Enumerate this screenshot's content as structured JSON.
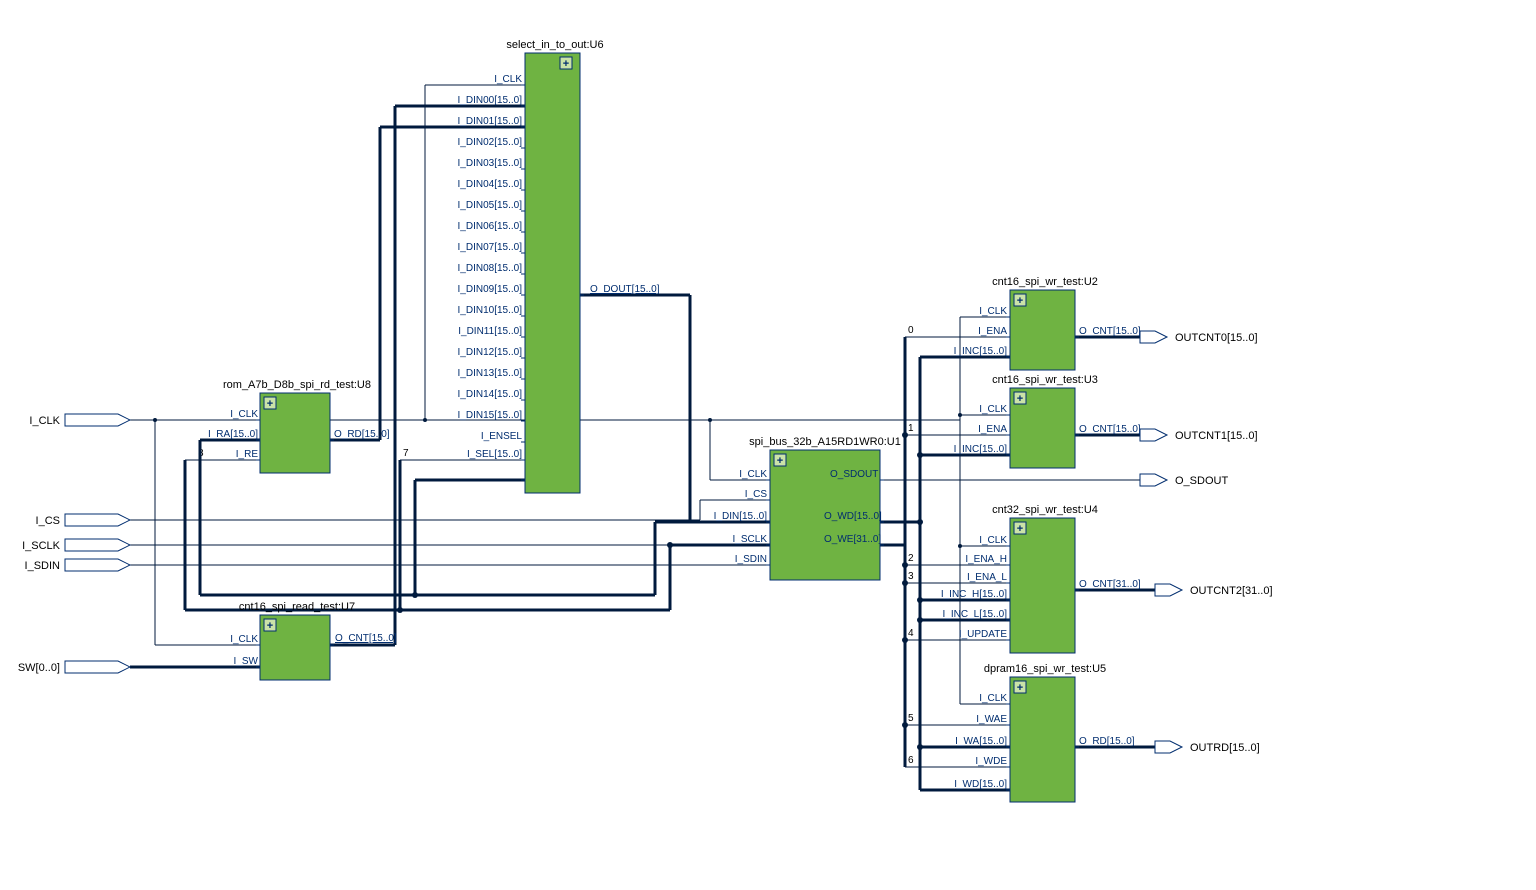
{
  "inputs": {
    "i_clk": "I_CLK",
    "i_cs": "I_CS",
    "i_sclk": "I_SCLK",
    "i_sdin": "I_SDIN",
    "sw": "SW[0..0]"
  },
  "outputs": {
    "outcnt0": "OUTCNT0[15..0]",
    "outcnt1": "OUTCNT1[15..0]",
    "o_sdout": "O_SDOUT",
    "outcnt2": "OUTCNT2[31..0]",
    "outrd": "OUTRD[15..0]"
  },
  "blocks": {
    "u8": {
      "title": "rom_A7b_D8b_spi_rd_test:U8",
      "pins_left": [
        "I_CLK",
        "I_RA[15..0]",
        "I_RE"
      ],
      "pins_right": [
        "O_RD[15..0]"
      ]
    },
    "u7": {
      "title": "cnt16_spi_read_test:U7",
      "pins_left": [
        "I_CLK",
        "I_SW"
      ],
      "pins_right": [
        "O_CNT[15..0]"
      ]
    },
    "u6": {
      "title": "select_in_to_out:U6",
      "pins_left": [
        "I_CLK",
        "I_DIN00[15..0]",
        "I_DIN01[15..0]",
        "I_DIN02[15..0]",
        "I_DIN03[15..0]",
        "I_DIN04[15..0]",
        "I_DIN05[15..0]",
        "I_DIN06[15..0]",
        "I_DIN07[15..0]",
        "I_DIN08[15..0]",
        "I_DIN09[15..0]",
        "I_DIN10[15..0]",
        "I_DIN11[15..0]",
        "I_DIN12[15..0]",
        "I_DIN13[15..0]",
        "I_DIN14[15..0]",
        "I_DIN15[15..0]",
        "I_ENSEL",
        "I_SEL[15..0]"
      ],
      "pins_right": [
        "O_DOUT[15..0]"
      ]
    },
    "u1": {
      "title": "spi_bus_32b_A15RD1WR0:U1",
      "pins_left": [
        "I_CLK",
        "I_CS",
        "I_DIN[15..0]",
        "I_SCLK",
        "I_SDIN"
      ],
      "pins_right": [
        "O_SDOUT",
        "O_WD[15..0]",
        "O_WE[31..0]"
      ]
    },
    "u2": {
      "title": "cnt16_spi_wr_test:U2",
      "pins_left": [
        "I_CLK",
        "I_ENA",
        "I_INC[15..0]"
      ],
      "pins_right": [
        "O_CNT[15..0]"
      ]
    },
    "u3": {
      "title": "cnt16_spi_wr_test:U3",
      "pins_left": [
        "I_CLK",
        "I_ENA",
        "I_INC[15..0]"
      ],
      "pins_right": [
        "O_CNT[15..0]"
      ]
    },
    "u4": {
      "title": "cnt32_spi_wr_test:U4",
      "pins_left": [
        "I_CLK",
        "I_ENA_H",
        "I_ENA_L",
        "I_INC_H[15..0]",
        "I_INC_L[15..0]",
        "I_UPDATE"
      ],
      "pins_right": [
        "O_CNT[31..0]"
      ]
    },
    "u5": {
      "title": "dpram16_spi_wr_test:U5",
      "pins_left": [
        "I_CLK",
        "I_WAE",
        "I_WA[15..0]",
        "I_WDE",
        "I_WD[15..0]"
      ],
      "pins_right": [
        "O_RD[15..0]"
      ]
    }
  },
  "bus_indices": [
    "0",
    "1",
    "2",
    "3",
    "4",
    "5",
    "6",
    "7",
    "8"
  ]
}
